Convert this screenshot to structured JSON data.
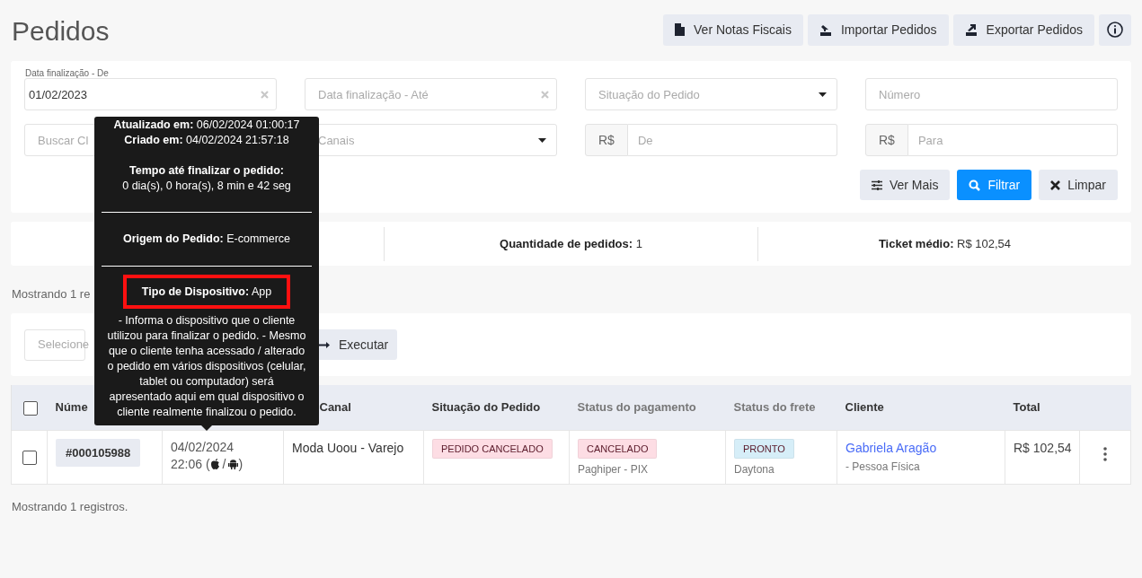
{
  "title": "Pedidos",
  "header_buttons": [
    {
      "kind": "doc",
      "label": "Ver Notas Fiscais"
    },
    {
      "kind": "import",
      "label": "Importar Pedidos"
    },
    {
      "kind": "export",
      "label": "Exportar Pedidos"
    },
    {
      "kind": "info"
    }
  ],
  "filters": {
    "date_from": {
      "label": "Data finalização - De",
      "value": "01/02/2023"
    },
    "date_to": {
      "placeholder": "Data finalização - Até"
    },
    "status": {
      "placeholder": "Situação do Pedido"
    },
    "number": {
      "placeholder": "Número"
    },
    "client": {
      "placeholder": "Buscar Cl"
    },
    "channels": {
      "placeholder": "Canais"
    },
    "min": {
      "prefix": "R$",
      "placeholder": "De"
    },
    "max": {
      "prefix": "R$",
      "placeholder": "Para"
    }
  },
  "filter_buttons": [
    {
      "kind": "more",
      "label": "Ver Mais"
    },
    {
      "kind": "filter",
      "label": "Filtrar"
    },
    {
      "kind": "clear",
      "label": "Limpar"
    }
  ],
  "stats": [
    {
      "label": "Quantidade de pedidos:",
      "value": "1"
    },
    {
      "label": "Ticket médio:",
      "value": "R$ 102,54"
    }
  ],
  "showing_top": "Mostrando 1 re",
  "bulk": {
    "placeholder": "Selecione",
    "button": "Executar"
  },
  "table": {
    "select_all": {
      "checked": false
    },
    "columns": [
      "Núme",
      "",
      "Canal",
      "Situação do Pedido",
      "Status do pagamento",
      "Status do frete",
      "Cliente",
      "Total"
    ],
    "rows": [
      {
        "checked": false,
        "number": "#000105988",
        "date": "04/02/2024",
        "time": "22:06",
        "device_open": "(",
        "device_sep": "/",
        "device_close": ")",
        "channel": "Moda Uoou - Varejo",
        "situation": {
          "text": "PEDIDO CANCELADO",
          "color": "#fddde4"
        },
        "payment": {
          "text": "CANCELADO",
          "color": "#fddde4",
          "sub": "Paghiper - PIX"
        },
        "shipping": {
          "text": "PRONTO",
          "color": "#d6eef8",
          "sub": "Daytona"
        },
        "client": "Gabriela Aragão",
        "client_type": "- Pessoa Física",
        "total": "R$ 102,54"
      }
    ]
  },
  "showing_bottom": "Mostrando 1 registros.",
  "tooltip": {
    "lines": [
      [
        "**Atualizado em:** 06/02/2024 01:00:17",
        "**Criado em:** 04/02/2024 21:57:18"
      ],
      [
        "**Tempo até finalizar o pedido:**",
        "0 dia(s), 0 hora(s), 8 min e 42 seg"
      ]
    ],
    "origin": "**Origem do Pedido:** E-commerce",
    "device": {
      "text": "**Tipo de Dispositivo:** App",
      "highlighted": true
    },
    "note": "- Informa o dispositivo que o cliente utilizou para finalizar o pedido. - Mesmo que o cliente tenha acessado / alterado o pedido em vários dispositivos (celular, tablet ou computador) será apresentado aqui em qual dispositivo o cliente realmente finalizou o pedido."
  }
}
